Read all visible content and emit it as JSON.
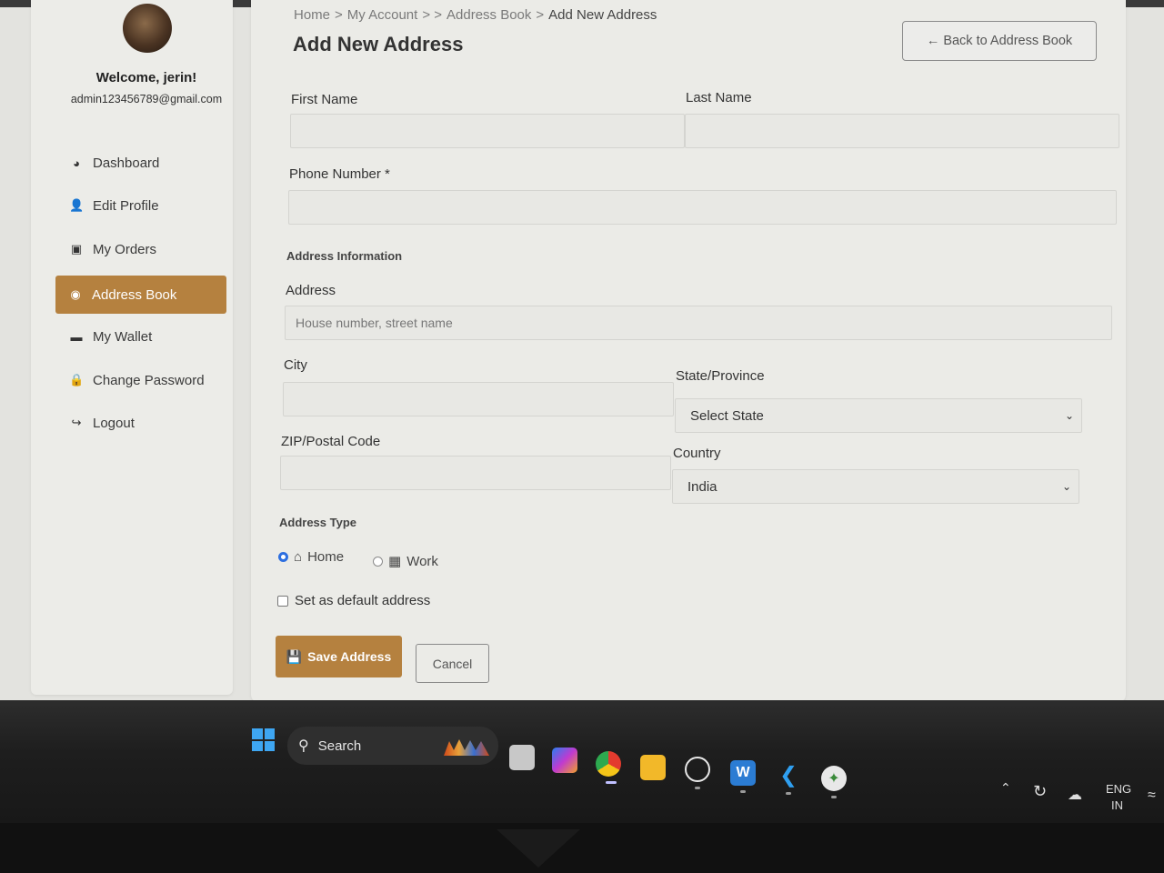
{
  "sidebar": {
    "welcome": "Welcome, jerin!",
    "email": "admin123456789@gmail.com",
    "items": [
      {
        "label": "Dashboard",
        "icon": "palette-icon"
      },
      {
        "label": "Edit Profile",
        "icon": "user-edit-icon"
      },
      {
        "label": "My Orders",
        "icon": "shopping-bag-icon"
      },
      {
        "label": "Address Book",
        "icon": "map-marker-icon",
        "active": true
      },
      {
        "label": "My Wallet",
        "icon": "wallet-icon"
      },
      {
        "label": "Change Password",
        "icon": "lock-icon"
      },
      {
        "label": "Logout",
        "icon": "sign-out-icon"
      }
    ]
  },
  "breadcrumb": {
    "home": "Home",
    "sep1": ">",
    "account": "My Account",
    "sep2": "> >",
    "address_book": "Address Book",
    "sep3": ">",
    "current": "Add New Address"
  },
  "page": {
    "title": "Add New Address",
    "back_button": "Back to Address Book"
  },
  "form": {
    "first_name": {
      "label": "First Name",
      "value": ""
    },
    "last_name": {
      "label": "Last Name",
      "value": ""
    },
    "phone": {
      "label": "Phone Number *",
      "value": ""
    },
    "address_section": "Address Information",
    "address": {
      "label": "Address",
      "placeholder": "House number, street name"
    },
    "city": {
      "label": "City",
      "value": ""
    },
    "state": {
      "label": "State/Province",
      "selected": "Select State"
    },
    "zip": {
      "label": "ZIP/Postal Code",
      "value": ""
    },
    "country": {
      "label": "Country",
      "selected": "India"
    },
    "address_type": {
      "label": "Address Type",
      "options": [
        {
          "label": "Home",
          "icon": "home-icon",
          "checked": true
        },
        {
          "label": "Work",
          "icon": "building-icon",
          "checked": false
        }
      ]
    },
    "default_checkbox": {
      "label": "Set as default address",
      "checked": false
    },
    "save_button": "Save Address",
    "cancel_button": "Cancel"
  },
  "taskbar": {
    "search_label": "Search",
    "tray_lang": "ENG",
    "tray_region": "IN"
  },
  "colors": {
    "accent": "#b5813f",
    "radio_selected": "#2d6fe0"
  }
}
